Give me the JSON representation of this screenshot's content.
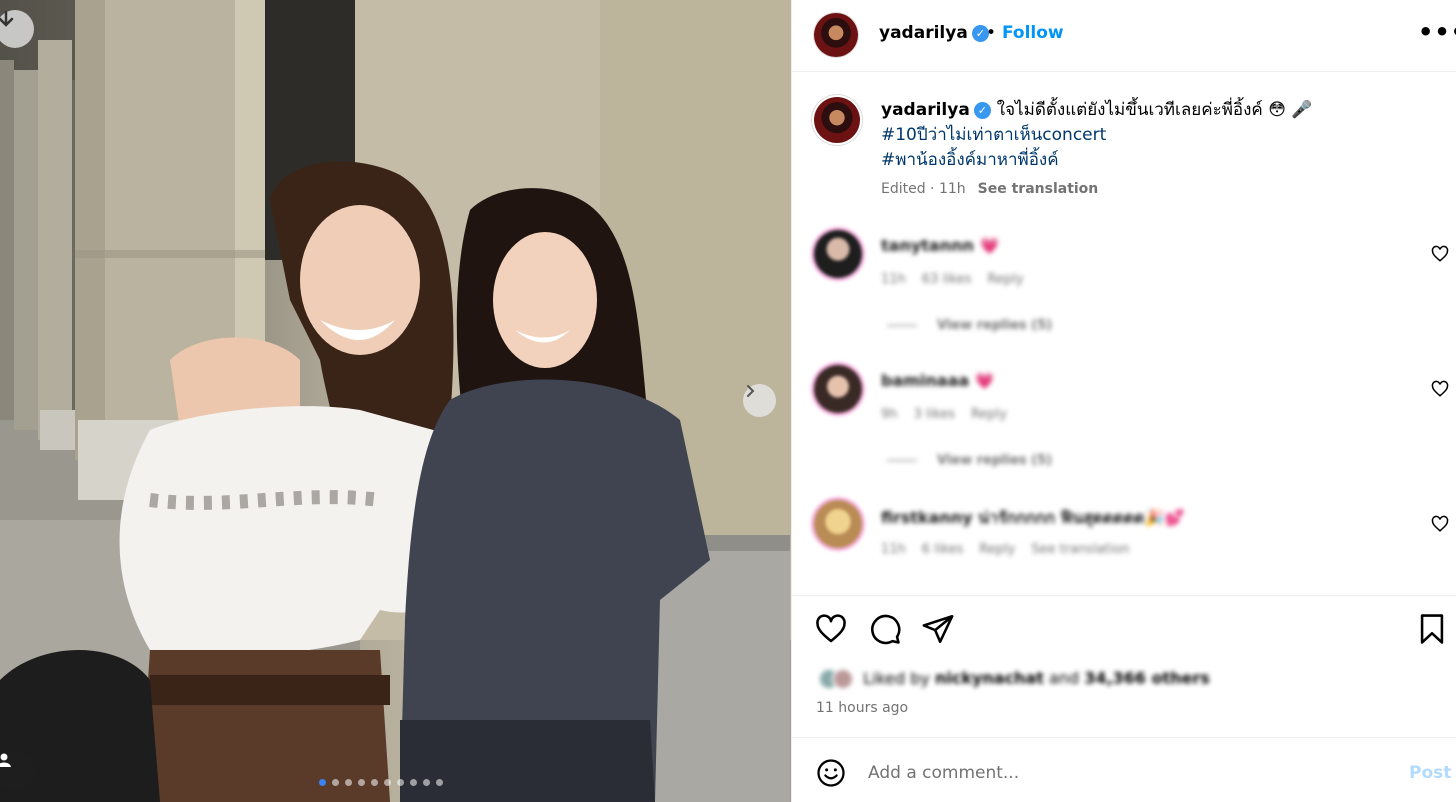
{
  "media": {
    "current_slide": 1,
    "total_slides": 10,
    "accent": "#3b82f6"
  },
  "header": {
    "username": "yadarilya",
    "separator": "•",
    "follow_label": "Follow",
    "more_label": "•••"
  },
  "caption": {
    "username": "yadarilya",
    "text": "ใจไม่ดีตั้งแต่ยังไม่ขึ้นเวทีเลยค่ะพี่อิ้งค์ 😳 🎤",
    "hashtags": [
      "#10ปีว่าไม่เท่าตาเห็นconcert",
      "#พาน้องอิ้งค์มาหาพี่อิ้งค์"
    ],
    "edited": "Edited · 11h",
    "see_translation": "See translation"
  },
  "comments": [
    {
      "username": "tanytannn",
      "text": "💗",
      "time": "11h",
      "likes": "63 likes",
      "reply": "Reply",
      "view_replies": "View replies (5)"
    },
    {
      "username": "baminaaa",
      "text": "💗",
      "time": "9h",
      "likes": "3 likes",
      "reply": "Reply",
      "view_replies": "View replies (5)"
    },
    {
      "username": "firstkanny",
      "text": "น่ารักกกกก ฟินสุดดดดด🎉💕",
      "time": "11h",
      "likes": "6 likes",
      "reply": "Reply",
      "see_translation": "See translation"
    }
  ],
  "likes": {
    "prefix": "Liked by",
    "user": "nickynachat",
    "and": "and",
    "others": "34,366 others"
  },
  "timestamp": "11 hours ago",
  "comment_box": {
    "placeholder": "Add a comment...",
    "post_label": "Post"
  }
}
